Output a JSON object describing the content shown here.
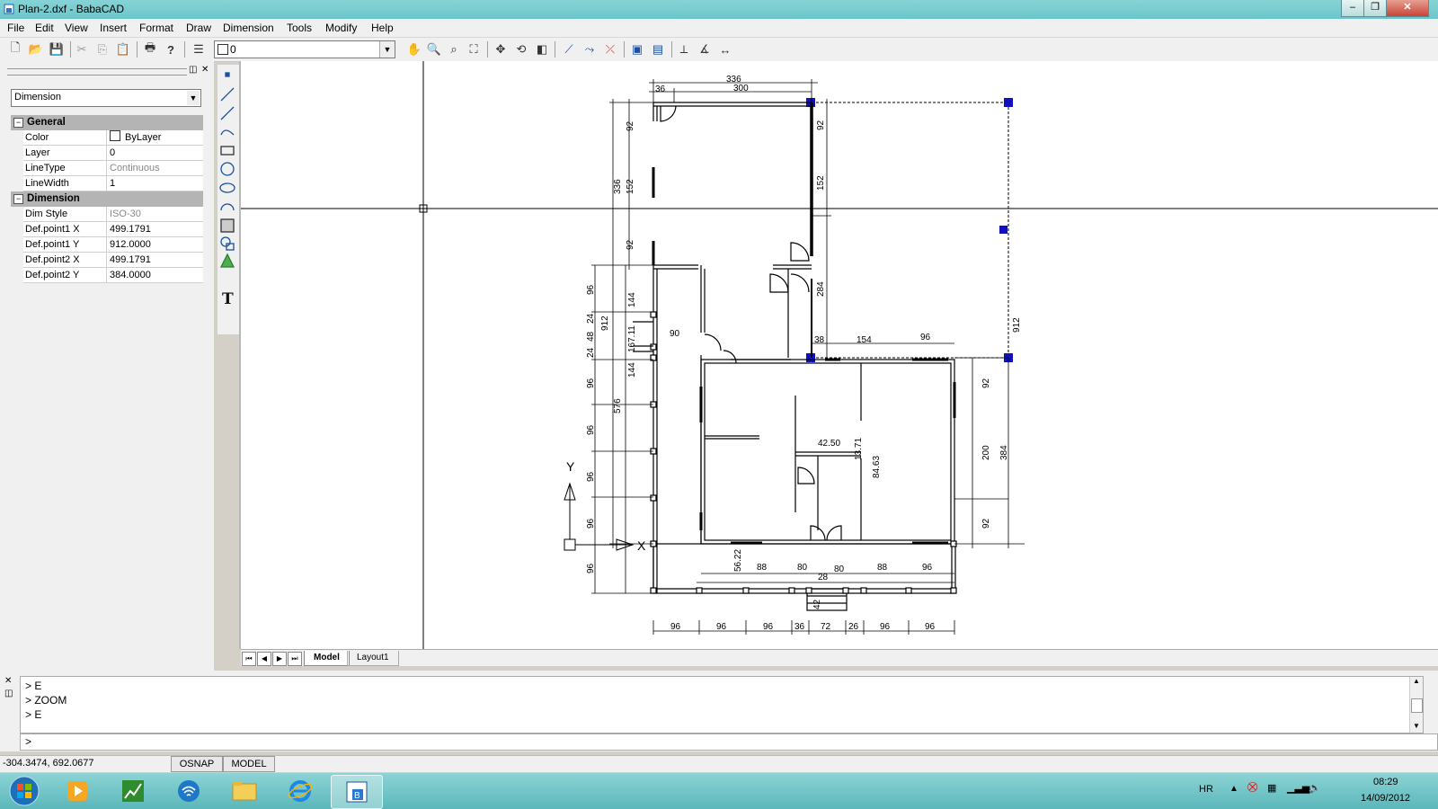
{
  "window": {
    "title": "Plan-2.dxf - BabaCAD"
  },
  "menu": [
    "File",
    "Edit",
    "View",
    "Insert",
    "Format",
    "Draw",
    "Dimension",
    "Tools",
    "Modify",
    "Help"
  ],
  "toolbar": {
    "layer_value": "0"
  },
  "panel": {
    "entity_type": "Dimension",
    "general": {
      "title": "General",
      "rows": [
        {
          "name": "Color",
          "value": "ByLayer"
        },
        {
          "name": "Layer",
          "value": "0"
        },
        {
          "name": "LineType",
          "value": "Continuous"
        },
        {
          "name": "LineWidth",
          "value": "1"
        }
      ]
    },
    "dimension": {
      "title": "Dimension",
      "rows": [
        {
          "name": "Dim Style",
          "value": "ISO-30"
        },
        {
          "name": "Def.point1 X",
          "value": "499.1791"
        },
        {
          "name": "Def.point1 Y",
          "value": "912.0000"
        },
        {
          "name": "Def.point2 X",
          "value": "499.1791"
        },
        {
          "name": "Def.point2 Y",
          "value": "384.0000"
        }
      ]
    }
  },
  "drawing": {
    "dims_top": [
      "336",
      "300",
      "36"
    ],
    "dims_right": [
      "92",
      "152",
      "284",
      "912",
      "384",
      "200",
      "92",
      "92"
    ],
    "dims_left": [
      "336",
      "152",
      "92",
      "92",
      "96",
      "24",
      "48",
      "24",
      "96",
      "96",
      "96",
      "96",
      "96",
      "576",
      "912",
      "144",
      "144",
      "167.11",
      "90"
    ],
    "dims_bottom": [
      "96",
      "96",
      "96",
      "36",
      "72",
      "26",
      "96",
      "96"
    ],
    "dims_inner": [
      "38",
      "154",
      "96",
      "42.50",
      "13.71",
      "84.63",
      "56.22",
      "88",
      "80",
      "80",
      "28",
      "88",
      "96",
      "42"
    ],
    "ucs": {
      "y_label": "Y",
      "x_label": "X"
    }
  },
  "tabs": {
    "model": "Model",
    "layout": "Layout1"
  },
  "command": {
    "history": [
      "> E",
      "> ZOOM",
      "> E"
    ],
    "prompt": ">"
  },
  "status": {
    "coords": "-304.3474, 692.0677",
    "osnap": "OSNAP",
    "model": "MODEL"
  },
  "taskbar": {
    "lang": "HR",
    "time": "08:29",
    "date": "14/09/2012"
  }
}
